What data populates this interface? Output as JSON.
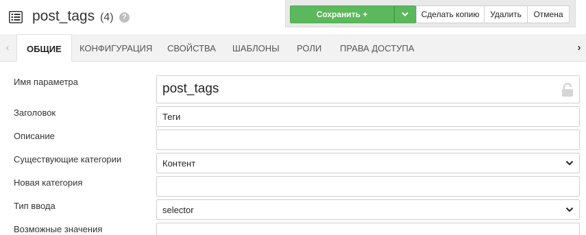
{
  "header": {
    "title": "post_tags",
    "count": "(4)",
    "help": "?"
  },
  "toolbar": {
    "save_label": "Сохранить + Продолжить",
    "copy_label": "Сделать копию",
    "delete_label": "Удалить",
    "cancel_label": "Отмена"
  },
  "tabs": [
    {
      "label": "ОБЩИЕ",
      "active": true
    },
    {
      "label": "КОНФИГУРАЦИЯ"
    },
    {
      "label": "СВОЙСТВА"
    },
    {
      "label": "ШАБЛОНЫ"
    },
    {
      "label": "РОЛИ"
    },
    {
      "label": "ПРАВА ДОСТУПА"
    }
  ],
  "form": {
    "name": {
      "label": "Имя параметра",
      "value": "post_tags"
    },
    "caption": {
      "label": "Заголовок",
      "value": "Теги"
    },
    "description": {
      "label": "Описание",
      "value": ""
    },
    "existing_categories": {
      "label": "Существующие категории",
      "value": "Контент"
    },
    "new_category": {
      "label": "Новая категория",
      "value": ""
    },
    "input_type": {
      "label": "Тип ввода",
      "value": "selector"
    },
    "possible_values": {
      "label": "Возможные значения",
      "value": ""
    }
  },
  "colors": {
    "accent_green": "#5cb85c",
    "tab_bar": "#f2f2f2"
  },
  "icons": {
    "page": "list-icon",
    "help": "question-circle-icon",
    "lock": "lock-icon",
    "chevron": "chevron-down-icon"
  }
}
